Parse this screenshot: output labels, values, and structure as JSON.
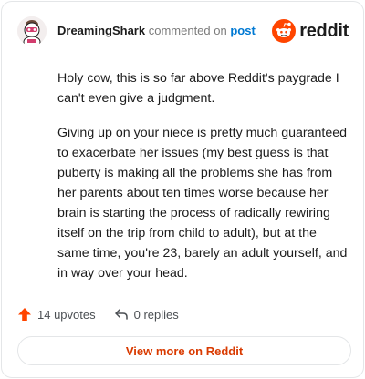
{
  "header": {
    "username": "DreamingShark",
    "action_text": "commented on",
    "post_link": "post",
    "brand_icon": "reddit-snoo-icon",
    "brand_name": "reddit"
  },
  "comment": {
    "paragraphs": [
      "Holy cow, this is so far above Reddit's paygrade I can't even give a judgment.",
      "Giving up on your niece is pretty much guaranteed to exacerbate her issues (my best guess is that puberty is making all the problems she has from her parents about ten times worse because her brain is starting the process of radically rewiring itself on the trip from child to adult), but at the same time, you're 23, barely an adult yourself, and in way over your head."
    ]
  },
  "actions": {
    "upvotes_label": "14 upvotes",
    "replies_label": "0 replies"
  },
  "footer": {
    "view_more_label": "View more on Reddit"
  },
  "colors": {
    "accent": "#ff4500",
    "link": "#0079d3",
    "button_text": "#d93a00"
  }
}
